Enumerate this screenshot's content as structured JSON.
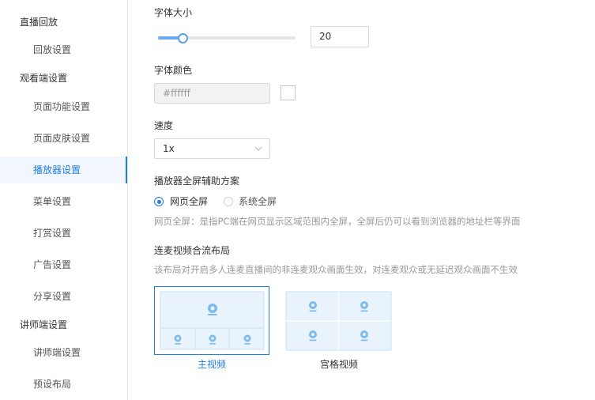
{
  "sidebar": {
    "groups": [
      {
        "label": "直播回放",
        "items": [
          {
            "label": "回放设置"
          }
        ]
      },
      {
        "label": "观看端设置",
        "items": [
          {
            "label": "页面功能设置"
          },
          {
            "label": "页面皮肤设置"
          },
          {
            "label": "播放器设置",
            "active": true
          },
          {
            "label": "菜单设置"
          },
          {
            "label": "打赏设置"
          },
          {
            "label": "广告设置"
          },
          {
            "label": "分享设置"
          }
        ]
      },
      {
        "label": "讲师端设置",
        "items": [
          {
            "label": "讲师端设置"
          },
          {
            "label": "预设布局"
          }
        ]
      }
    ]
  },
  "font_size": {
    "label": "字体大小",
    "value": "20",
    "slider_fraction": 0.18
  },
  "font_color": {
    "label": "字体颜色",
    "value": "#ffffff",
    "swatch_color": "#ffffff"
  },
  "speed": {
    "label": "速度",
    "value": "1x"
  },
  "fullscreen": {
    "label": "播放器全屏辅助方案",
    "options": [
      {
        "label": "网页全屏",
        "checked": true
      },
      {
        "label": "系统全屏",
        "checked": false
      }
    ],
    "hint": "网页全屏：是指PC端在网页显示区域范围内全屏，全屏后仍可以看到浏览器的地址栏等界面"
  },
  "mic_layout": {
    "label": "连麦视频合流布局",
    "hint": "该布局对开启多人连麦直播间的非连麦观众画面生效，对连麦观众或无延迟观众画面不生效",
    "options": [
      {
        "label": "主视频",
        "selected": true,
        "icon": "camera-icon"
      },
      {
        "label": "宫格视频",
        "selected": false,
        "icon": "camera-icon"
      }
    ]
  },
  "colors": {
    "accent": "#1f7ee3",
    "border": "#d9d9d9",
    "tile_bg": "#e8f3fc",
    "icon": "#7dbbec"
  }
}
